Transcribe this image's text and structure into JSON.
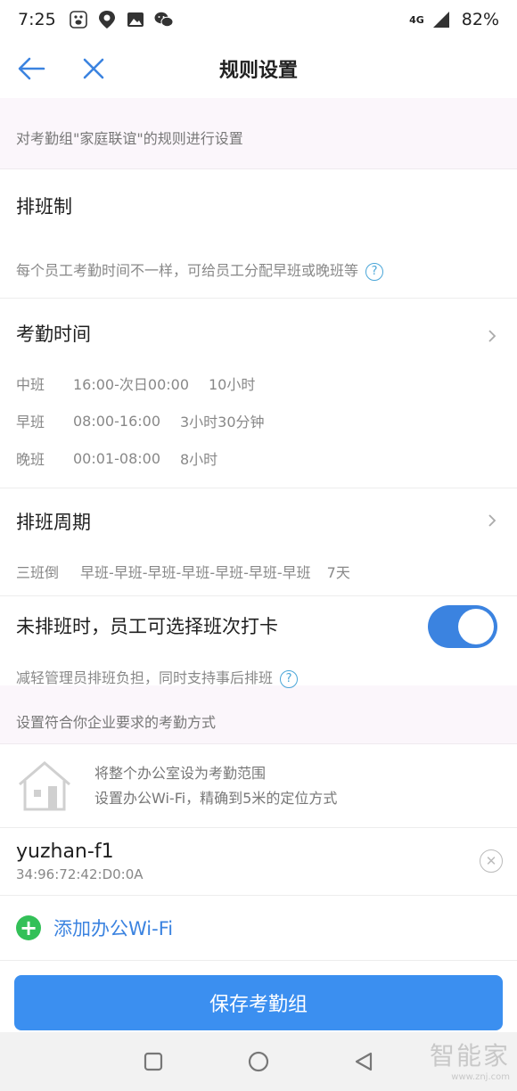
{
  "status_bar": {
    "time": "7:25",
    "network": "4G",
    "battery": "82%",
    "icons": [
      "baidu-paw-icon",
      "baidu-map-icon",
      "gallery-icon",
      "wechat-icon"
    ]
  },
  "header": {
    "title": "规则设置"
  },
  "rule_desc": "对考勤组\"家庭联谊\"的规则进行设置",
  "schedule_type": {
    "title": "排班制",
    "description": "每个员工考勤时间不一样，可给员工分配早班或晚班等",
    "help": "?"
  },
  "attendance_time": {
    "title": "考勤时间",
    "shifts": [
      {
        "name": "中班",
        "time": "16:00-次日00:00",
        "duration": "10小时"
      },
      {
        "name": "早班",
        "time": "08:00-16:00",
        "duration": "3小时30分钟"
      },
      {
        "name": "晚班",
        "time": "00:01-08:00",
        "duration": "8小时"
      }
    ]
  },
  "schedule_cycle": {
    "title": "排班周期",
    "name": "三班倒",
    "pattern": "早班-早班-早班-早班-早班-早班-早班",
    "days": "7天"
  },
  "self_select": {
    "title": "未排班时，员工可选择班次打卡",
    "enabled": true,
    "description": "减轻管理员排班负担，同时支持事后排班",
    "help": "?"
  },
  "method_desc": "设置符合你企业要求的考勤方式",
  "wifi_intro": {
    "line1": "将整个办公室设为考勤范围",
    "line2": "设置办公Wi-Fi，精确到5米的定位方式"
  },
  "wifi_list": [
    {
      "ssid": "yuzhan-f1",
      "mac": "34:96:72:42:D0:0A"
    }
  ],
  "add_wifi_label": "添加办公Wi-Fi",
  "save_label": "保存考勤组",
  "watermark": {
    "main": "智能家",
    "sub": "www.znj.com"
  },
  "colors": {
    "accent": "#3b83e0",
    "add_green": "#33c058",
    "tint": "#fbf6fb"
  }
}
